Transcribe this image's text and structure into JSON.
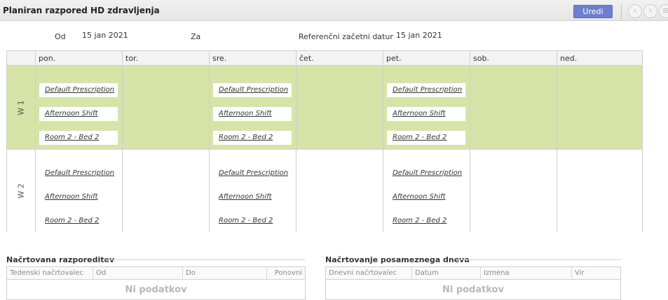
{
  "header": {
    "title": "Planiran razpored HD zdravljenja",
    "edit_label": "Uredi",
    "nav_prev": "‹",
    "nav_next": "›",
    "nav_more": "≡"
  },
  "filters": {
    "od_label": "Od",
    "od_value": "15 jan 2021",
    "za_label": "Za",
    "za_value": "",
    "ref_label": "Referenčni začetni datum",
    "ref_value": "15 jan 2021"
  },
  "days": [
    "pon.",
    "tor.",
    "sre.",
    "čet.",
    "pet.",
    "sob.",
    "ned."
  ],
  "weeks": [
    {
      "label": "W 1",
      "days": [
        [
          "Default Prescription",
          "Afternoon Shift",
          "Room 2 - Bed 2"
        ],
        [],
        [
          "Default Prescription",
          "Afternoon Shift",
          "Room 2 - Bed 2"
        ],
        [],
        [
          "Default Prescription",
          "Afternoon Shift",
          "Room 2 - Bed 2"
        ],
        [],
        []
      ]
    },
    {
      "label": "W 2",
      "days": [
        [
          "Default Prescription",
          "Afternoon Shift",
          "Room 2 - Bed 2"
        ],
        [],
        [
          "Default Prescription",
          "Afternoon Shift",
          "Room 2 - Bed 2"
        ],
        [],
        [
          "Default Prescription",
          "Afternoon Shift",
          "Room 2 - Bed 2"
        ],
        [],
        []
      ]
    }
  ],
  "planned_section": {
    "title": "Načrtovana razporeditev",
    "columns": [
      "Tedenski načrtovalec",
      "Od",
      "Do",
      "Ponovni"
    ],
    "empty_text": "Ni podatkov"
  },
  "single_day_section": {
    "title": "Načrtovanje posameznega dneva",
    "columns": [
      "Dnevni načrtovalec",
      "Datum",
      "Izmena",
      "Vir"
    ],
    "empty_text": "Ni podatkov"
  },
  "colors": {
    "week_highlight": "#d6e4a8",
    "edit_button": "#6f7fcf"
  }
}
